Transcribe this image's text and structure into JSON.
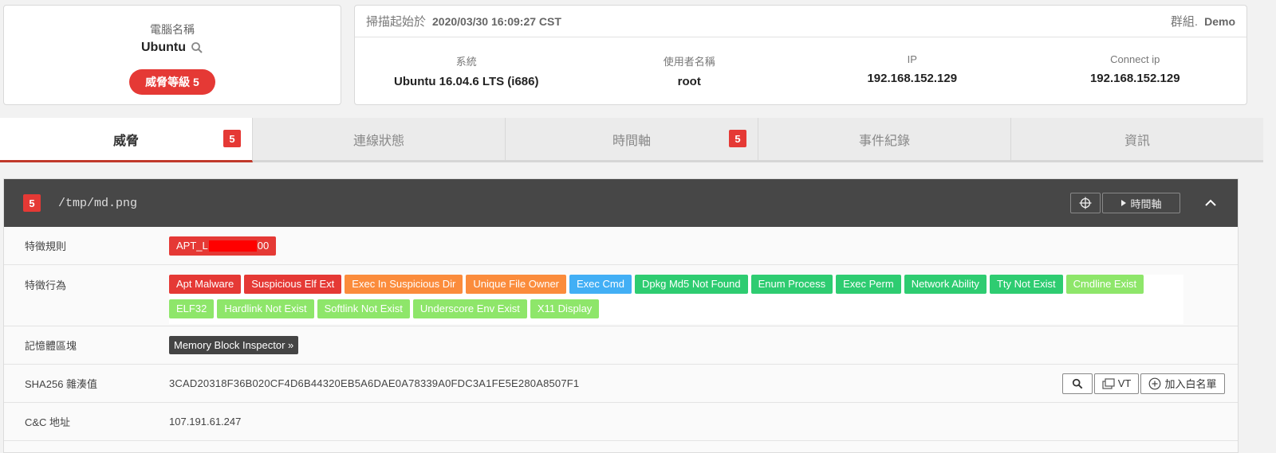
{
  "host": {
    "label": "電腦名稱",
    "name": "Ubuntu",
    "threat_level": "威脅等級 5"
  },
  "scan": {
    "start_label": "掃描起始於",
    "start_value": "2020/03/30 16:09:27 CST",
    "group_label": "群組.",
    "group_value": "Demo",
    "fields": [
      {
        "label": "系統",
        "value": "Ubuntu 16.04.6 LTS (i686)"
      },
      {
        "label": "使用者名稱",
        "value": "root"
      },
      {
        "label": "IP",
        "value": "192.168.152.129"
      },
      {
        "label": "Connect ip",
        "value": "192.168.152.129"
      }
    ]
  },
  "tabs": [
    {
      "label": "威脅",
      "badge": "5"
    },
    {
      "label": "連線狀態",
      "badge": ""
    },
    {
      "label": "時間軸",
      "badge": "5"
    },
    {
      "label": "事件紀錄",
      "badge": ""
    },
    {
      "label": "資訊",
      "badge": ""
    }
  ],
  "detail": {
    "badge": "5",
    "path": "/tmp/md.png",
    "timeline_btn": "時間軸",
    "rows": {
      "rule_label": "特徵規則",
      "rule_prefix": "APT_L",
      "rule_suffix": "00",
      "behavior_label": "特徵行為",
      "memory_label": "記憶體區塊",
      "memory_btn": "Memory Block Inspector »",
      "sha_label": "SHA256 雜湊值",
      "sha_value": "3CAD20318F36B020CF4D6B44320EB5A6DAE0A78339A0FDC3A1FE5E280A8507F1",
      "vt_btn": "VT",
      "whitelist_btn": "加入白名單",
      "cc_label": "C&C 地址",
      "cc_value": "107.191.61.247"
    },
    "behaviors": [
      {
        "label": "Apt Malware",
        "color": "#e53935"
      },
      {
        "label": "Suspicious Elf Ext",
        "color": "#e53935"
      },
      {
        "label": "Exec In Suspicious Dir",
        "color": "#fb8c3c"
      },
      {
        "label": "Unique File Owner",
        "color": "#fb8c3c"
      },
      {
        "label": "Exec Cmd",
        "color": "#42aff5"
      },
      {
        "label": "Dpkg Md5 Not Found",
        "color": "#2ecc71"
      },
      {
        "label": "Enum Process",
        "color": "#2ecc71"
      },
      {
        "label": "Exec Perm",
        "color": "#2ecc71"
      },
      {
        "label": "Network Ability",
        "color": "#2ecc71"
      },
      {
        "label": "Tty Not Exist",
        "color": "#2ecc71"
      },
      {
        "label": "Cmdline Exist",
        "color": "#8ee66a"
      },
      {
        "label": "ELF32",
        "color": "#8ee66a"
      },
      {
        "label": "Hardlink Not Exist",
        "color": "#8ee66a"
      },
      {
        "label": "Softlink Not Exist",
        "color": "#8ee66a"
      },
      {
        "label": "Underscore Env Exist",
        "color": "#8ee66a"
      },
      {
        "label": "X11 Display",
        "color": "#8ee66a"
      }
    ]
  }
}
